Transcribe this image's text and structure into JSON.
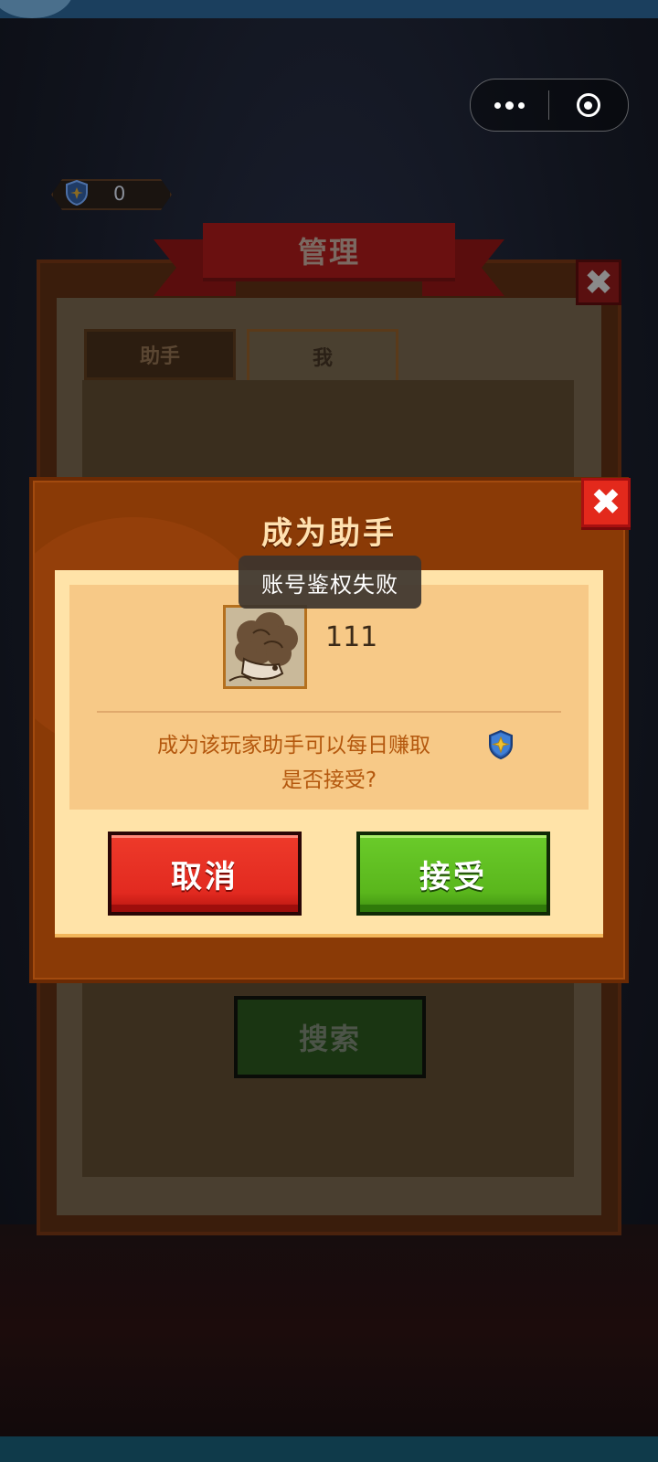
{
  "capsule": {
    "more_icon": "more-dots-icon",
    "close_icon": "target-circle-icon"
  },
  "currency": {
    "value": "0",
    "icon": "shield-star-icon"
  },
  "panel": {
    "title": "管理",
    "close_label": "✖",
    "tabs": [
      {
        "label": "助手"
      },
      {
        "label": "我"
      }
    ],
    "search_label": "搜索"
  },
  "modal": {
    "title": "成为助手",
    "close_label": "✖",
    "player_name": "111",
    "description_line1": "成为该玩家助手可以每日赚取",
    "description_line2": "是否接受?",
    "cancel_label": "取消",
    "accept_label": "接受",
    "colors": {
      "cancel": "#e22a20",
      "accept": "#5ab61c",
      "frame": "#8a3a06"
    }
  },
  "toast": {
    "text": "账号鉴权失败"
  }
}
